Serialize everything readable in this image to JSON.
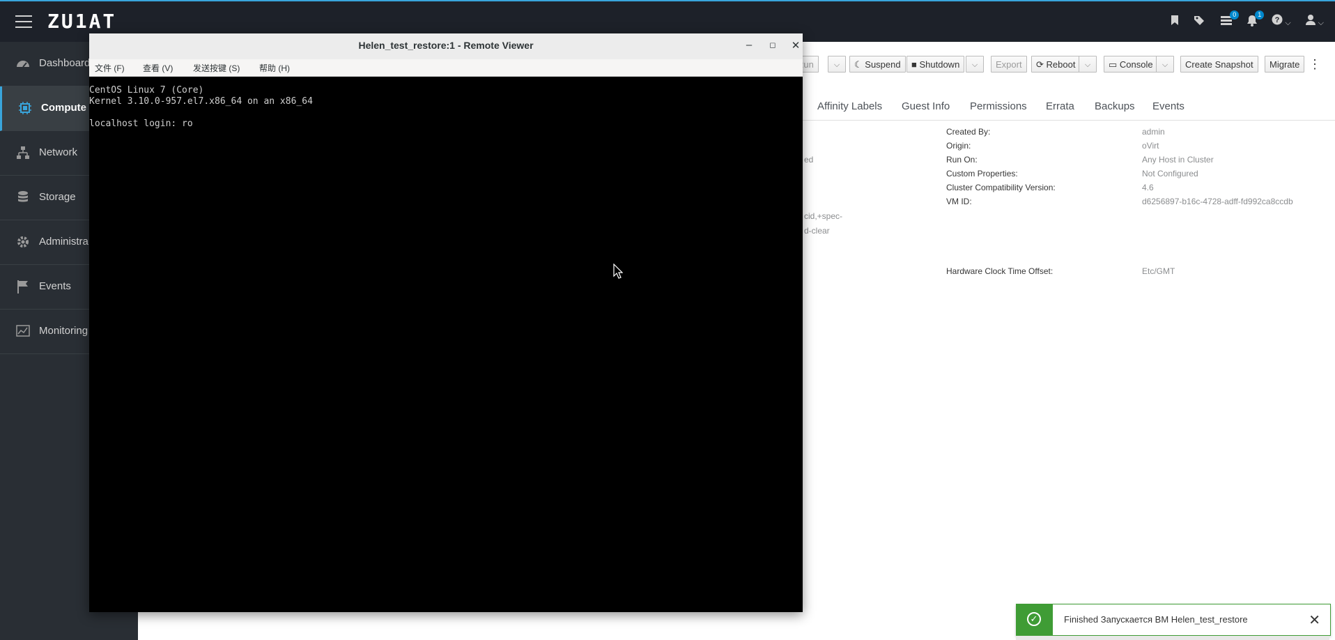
{
  "masthead": {
    "brand": "ZU1AT",
    "icons": [
      {
        "name": "bookmark-icon"
      },
      {
        "name": "tags-icon"
      },
      {
        "name": "tasks-icon",
        "badge": "0"
      },
      {
        "name": "bell-icon",
        "badge": "1"
      },
      {
        "name": "help-icon"
      },
      {
        "name": "user-icon"
      }
    ]
  },
  "sidebar": {
    "items": [
      {
        "label": "Dashboard",
        "icon": "dashboard-icon"
      },
      {
        "label": "Compute",
        "icon": "chip-icon",
        "active": true
      },
      {
        "label": "Network",
        "icon": "network-icon"
      },
      {
        "label": "Storage",
        "icon": "database-icon"
      },
      {
        "label": "Administra",
        "icon": "gear-icon"
      },
      {
        "label": "Events",
        "icon": "flag-icon"
      },
      {
        "label": "Monitoring",
        "icon": "chart-icon"
      }
    ]
  },
  "toolbar": {
    "run": "Run",
    "suspend": "Suspend",
    "shutdown": "Shutdown",
    "export": "Export",
    "reboot": "Reboot",
    "console": "Console",
    "create_snapshot": "Create Snapshot",
    "migrate": "Migrate"
  },
  "tabs": [
    "Affinity Labels",
    "Guest Info",
    "Permissions",
    "Errata",
    "Backups",
    "Events"
  ],
  "details": {
    "left_fragments": [
      "ed",
      "cid,+spec-",
      "d-clear"
    ],
    "rows": [
      {
        "label": "Created By:",
        "value": "admin"
      },
      {
        "label": "Origin:",
        "value": "oVirt"
      },
      {
        "label": "Run On:",
        "value": "Any Host in Cluster"
      },
      {
        "label": "Custom Properties:",
        "value": "Not Configured"
      },
      {
        "label": "Cluster Compatibility Version:",
        "value": "4.6"
      },
      {
        "label": "VM ID:",
        "value": "d6256897-b16c-4728-adff-fd992ca8ccdb"
      },
      {
        "label": "Hardware Clock Time Offset:",
        "value": "Etc/GMT"
      }
    ]
  },
  "remote_viewer": {
    "title": "Helen_test_restore:1 - Remote Viewer",
    "menu": [
      "文件 (F)",
      "查看 (V)",
      "发送按键 (S)",
      "帮助 (H)"
    ],
    "console_lines": [
      "CentOS Linux 7 (Core)",
      "Kernel 3.10.0-957.el7.x86_64 on an x86_64",
      "localhost login: ro"
    ]
  },
  "toast": {
    "message": "Finished Запускается ВМ Helen_test_restore",
    "status_color": "#3f9c35"
  },
  "colors": {
    "accent": "#39a5dc",
    "masthead": "#1d2129",
    "sidebar": "#292e34"
  }
}
